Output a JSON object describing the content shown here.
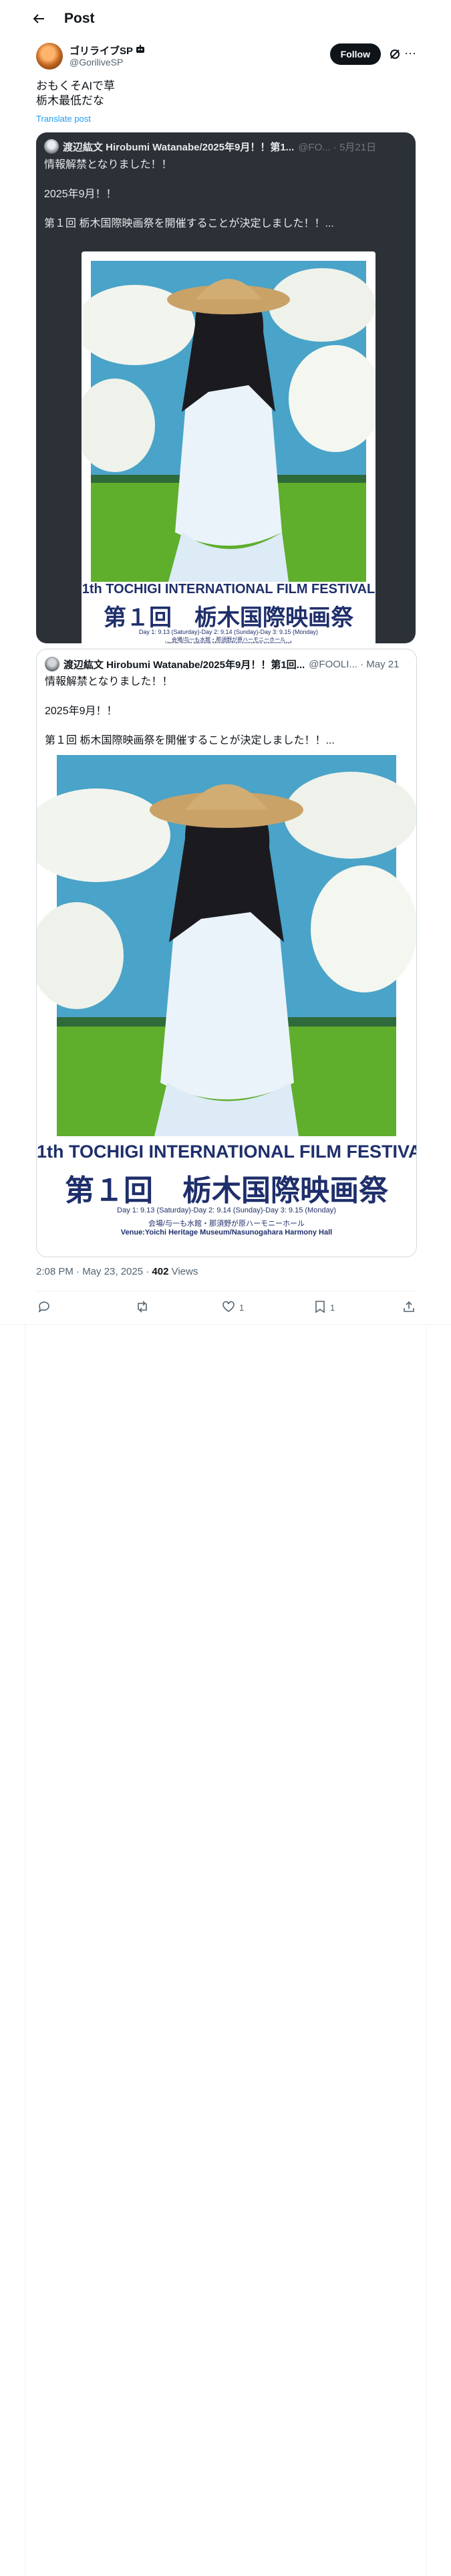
{
  "header": {
    "title": "Post"
  },
  "author": {
    "name": "ゴリライブSP",
    "handle": "@GoriliveSP",
    "follow_label": "Follow"
  },
  "post": {
    "text": "おもくそAIで草\n栃木最低だな",
    "translate_label": "Translate post",
    "time": "2:08 PM · May 23, 2025 · ",
    "views_count": "402",
    "views_label": " Views"
  },
  "quote_dark": {
    "name": "渡辺紘文 Hirobumi Watanabe/2025年9月！！第1...",
    "handle": "@FO... · 5月21日",
    "text": "情報解禁となりました！！\n\n2025年9月！！\n\n第１回 栃木国際映画祭を開催することが決定しました！！..."
  },
  "quote_light": {
    "name": "渡辺紘文 Hirobumi Watanabe/2025年9月！！第1回...",
    "handle": "@FOOLI... · May 21",
    "text": "情報解禁となりました！！\n\n2025年9月！！\n\n第１回 栃木国際映画祭を開催することが決定しました！！..."
  },
  "poster": {
    "title_en": "1th TOCHIGI INTERNATIONAL FILM FESTIVAL",
    "title_jp": "第１回　栃木国際映画祭",
    "dates": "Day 1: 9.13 (Saturday)-Day 2: 9.14 (Sunday)-Day 3: 9.15 (Monday)",
    "venue_jp": "会場/与一も水館・那須野が原ハーモニーホール",
    "venue_en": "Venue:Yoichi Heritage Museum/Nasunogahara Harmony Hall"
  },
  "actions": {
    "replies": "",
    "reposts": "",
    "likes": "1",
    "bookmarks": "1"
  },
  "colors": {
    "accent": "#1d9bf0",
    "poster_navy": "#1f2f6b",
    "dark_card": "#2b3137"
  }
}
